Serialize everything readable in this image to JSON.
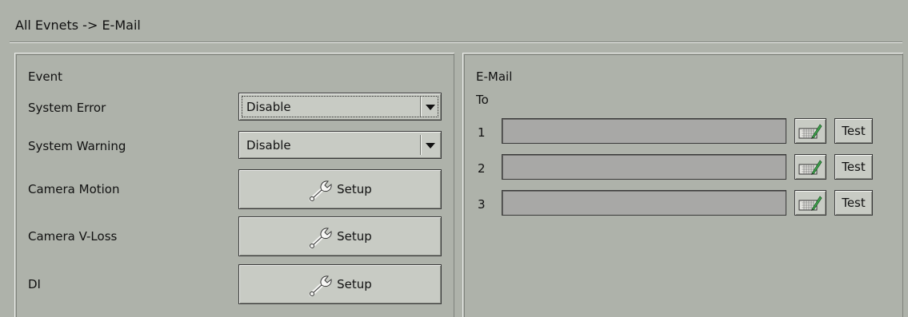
{
  "header": {
    "title": "All Evnets -> E-Mail"
  },
  "event_panel": {
    "title": "Event",
    "rows": [
      {
        "label": "System Error",
        "control": "dropdown",
        "value": "Disable"
      },
      {
        "label": "System Warning",
        "control": "dropdown",
        "value": "Disable"
      },
      {
        "label": "Camera Motion",
        "control": "button",
        "value": "Setup"
      },
      {
        "label": "Camera V-Loss",
        "control": "button",
        "value": "Setup"
      },
      {
        "label": "DI",
        "control": "button",
        "value": "Setup"
      }
    ]
  },
  "email_panel": {
    "title": "E-Mail",
    "to_label": "To",
    "recipients": [
      {
        "index": "1",
        "value": "",
        "test_label": "Test"
      },
      {
        "index": "2",
        "value": "",
        "test_label": "Test"
      },
      {
        "index": "3",
        "value": "",
        "test_label": "Test"
      }
    ]
  },
  "icons": {
    "setup": "wrench-icon",
    "keyboard": "keyboard-pencil-icon"
  },
  "colors": {
    "background": "#aeb2aa",
    "button_face": "#c8cbc4",
    "input_fill": "#a8a8a6"
  }
}
